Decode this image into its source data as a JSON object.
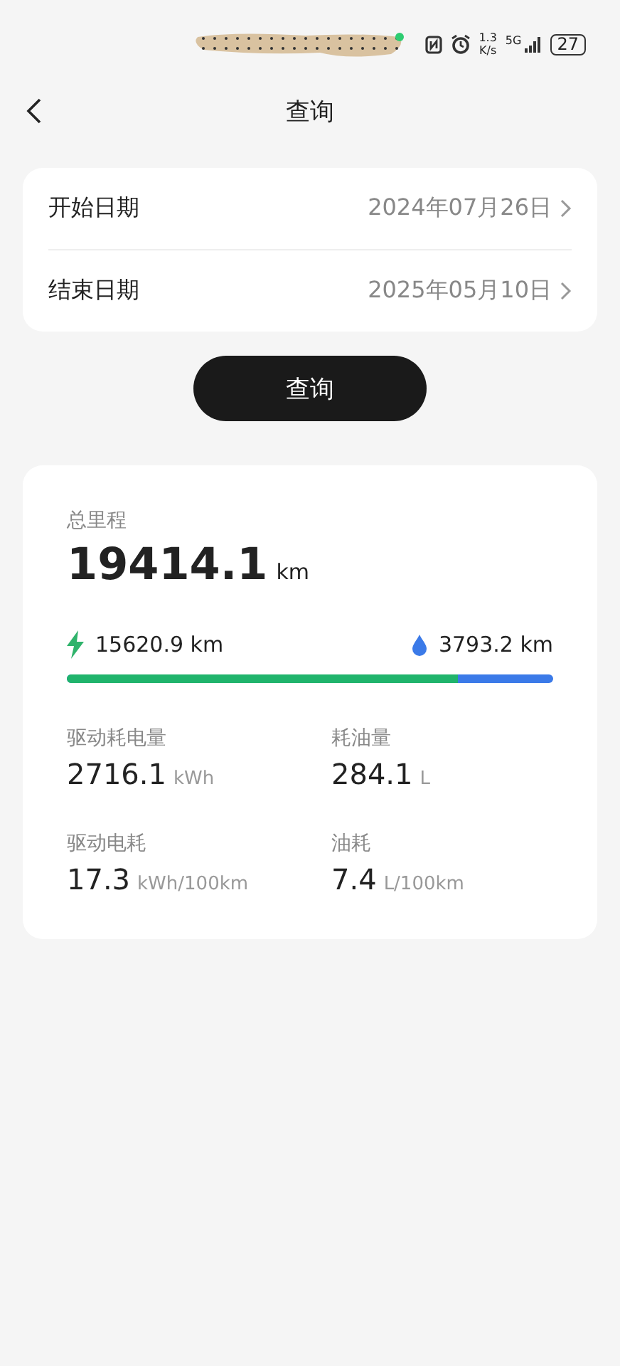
{
  "status_bar": {
    "speed": "1.3",
    "speed_unit": "K/s",
    "network": "5G",
    "battery": "27"
  },
  "header": {
    "title": "查询"
  },
  "date_rows": [
    {
      "label": "开始日期",
      "value": "2024年07月26日"
    },
    {
      "label": "结束日期",
      "value": "2025年05月10日"
    }
  ],
  "query_button": "查询",
  "summary": {
    "label": "总里程",
    "value": "19414.1",
    "unit": "km",
    "electric": {
      "value": "15620.9",
      "unit": "km"
    },
    "fuel": {
      "value": "3793.2",
      "unit": "km"
    },
    "level": 0.804
  },
  "stats": [
    {
      "label": "驱动耗电量",
      "value": "2716.1",
      "unit": "kWh"
    },
    {
      "label": "耗油量",
      "value": "284.1",
      "unit": "L"
    },
    {
      "label": "驱动电耗",
      "value": "17.3",
      "unit": "kWh/100km"
    },
    {
      "label": "油耗",
      "value": "7.4",
      "unit": "L/100km"
    }
  ]
}
